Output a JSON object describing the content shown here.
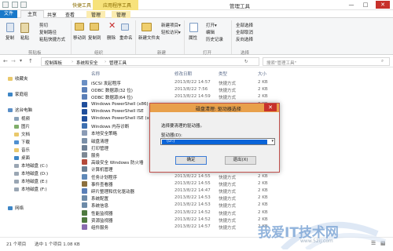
{
  "window": {
    "title": "管理工具",
    "contextual_groups": [
      "快捷工具",
      "应用程序工具"
    ],
    "controls": [
      "—",
      "□",
      "✕"
    ]
  },
  "ribbon_tabs": [
    "文件",
    "主页",
    "共享",
    "查看",
    "管理",
    "管理"
  ],
  "ribbon": {
    "clipboard": {
      "copy": "复制",
      "paste": "粘贴",
      "cut": "剪切",
      "copy_path": "复制路径",
      "paste_shortcut": "粘贴快捷方式",
      "group": "剪贴板"
    },
    "organize": {
      "move_to": "移动到",
      "copy_to": "复制到",
      "delete": "删除",
      "rename": "重命名",
      "group": "组织"
    },
    "new": {
      "new_folder": "新建文件夹",
      "new_item": "新建项目▾",
      "easy_access": "轻松访问▾",
      "group": "新建"
    },
    "open": {
      "properties": "属性",
      "open": "打开▾",
      "edit": "编辑",
      "history": "历史记录",
      "group": "打开"
    },
    "select": {
      "select_all": "全部选择",
      "select_none": "全部取消",
      "invert": "反向选择",
      "group": "选择"
    }
  },
  "address": {
    "path": [
      "控制面板",
      "系统和安全",
      "管理工具"
    ],
    "search_placeholder": "搜索\"管理工具\""
  },
  "columns": {
    "name": "名称",
    "date": "修改日期",
    "type": "类型",
    "size": "大小"
  },
  "files": [
    {
      "name": "iSCSI 发起程序",
      "date": "2013/8/22 14:57",
      "type": "快捷方式",
      "size": "2 KB",
      "color": "#6a8fc4"
    },
    {
      "name": "ODBC 数据源(32 位)",
      "date": "2013/8/22 7:56",
      "type": "快捷方式",
      "size": "2 KB",
      "color": "#5a7fb8"
    },
    {
      "name": "ODBC 数据源(64 位)",
      "date": "2013/8/22 14:59",
      "type": "快捷方式",
      "size": "2 KB",
      "color": "#5a7fb8"
    },
    {
      "name": "Windows PowerShell (x86)",
      "date": "",
      "type": "",
      "size": "3 KB",
      "color": "#1f4e9c"
    },
    {
      "name": "Windows PowerShell ISE",
      "date": "",
      "type": "",
      "size": "2 KB",
      "color": "#1f4e9c"
    },
    {
      "name": "Windows PowerShell ISE (x8",
      "date": "",
      "type": "",
      "size": "2 KB",
      "color": "#1f4e9c"
    },
    {
      "name": "Windows 内存诊断",
      "date": "",
      "type": "",
      "size": "2 KB",
      "color": "#3d6fb0"
    },
    {
      "name": "本地安全策略",
      "date": "",
      "type": "",
      "size": "2 KB",
      "color": "#8a9bb5"
    },
    {
      "name": "磁盘清理",
      "date": "",
      "type": "",
      "size": "2 KB",
      "color": "#7a8fa8"
    },
    {
      "name": "打印管理",
      "date": "",
      "type": "",
      "size": "2 KB",
      "color": "#6d7f95"
    },
    {
      "name": "服务",
      "date": "",
      "type": "",
      "size": "2 KB",
      "color": "#7d8894"
    },
    {
      "name": "高级安全 Windows 防火墙",
      "date": "2013/8/22 14:45",
      "type": "快捷方式",
      "size": "2 KB",
      "color": "#b44a3a"
    },
    {
      "name": "计算机管理",
      "date": "2013/8/22 14:54",
      "type": "快捷方式",
      "size": "2 KB",
      "color": "#6b8094"
    },
    {
      "name": "任务计划程序",
      "date": "2013/8/22 14:55",
      "type": "快捷方式",
      "size": "2 KB",
      "color": "#5f89b8"
    },
    {
      "name": "事件查看器",
      "date": "2013/8/22 14:55",
      "type": "快捷方式",
      "size": "2 KB",
      "color": "#8b6f3e"
    },
    {
      "name": "碎片整理和优化驱动器",
      "date": "2013/8/22 14:47",
      "type": "快捷方式",
      "size": "2 KB",
      "color": "#5a7fb8"
    },
    {
      "name": "系统配置",
      "date": "2013/8/22 14:53",
      "type": "快捷方式",
      "size": "2 KB",
      "color": "#6d8aa8"
    },
    {
      "name": "系统信息",
      "date": "2013/8/22 14:53",
      "type": "快捷方式",
      "size": "2 KB",
      "color": "#6d8aa8"
    },
    {
      "name": "性能监视器",
      "date": "2013/8/22 14:52",
      "type": "快捷方式",
      "size": "2 KB",
      "color": "#4e7a3f"
    },
    {
      "name": "资源监视器",
      "date": "2013/8/22 14:52",
      "type": "快捷方式",
      "size": "2 KB",
      "color": "#4e7a3f"
    },
    {
      "name": "组件服务",
      "date": "2013/8/22 14:57",
      "type": "快捷方式",
      "size": "2 KB",
      "color": "#8a6bb0"
    }
  ],
  "nav": {
    "favorites": "收藏夹",
    "homegroup": "家庭组",
    "this_pc": "这台电脑",
    "pc_items": [
      "视频",
      "图片",
      "文档",
      "下载",
      "音乐",
      "桌面",
      "本地磁盘 (C:)",
      "本地磁盘 (D:)",
      "本地磁盘 (E:)",
      "本地磁盘 (F:)"
    ],
    "network": "网络"
  },
  "status": {
    "count": "21 个项目",
    "selected": "选中 1 个项目 1.08 KB"
  },
  "dialog": {
    "title": "磁盘清理: 驱动器选择",
    "prompt": "选择要清理的驱动器。",
    "drive_label": "驱动器(D):",
    "drive_value": "(D:)",
    "ok": "确定",
    "exit": "退出(X)"
  },
  "watermark": {
    "text": "我爱IT技术网",
    "url": "www.52ij.com"
  }
}
